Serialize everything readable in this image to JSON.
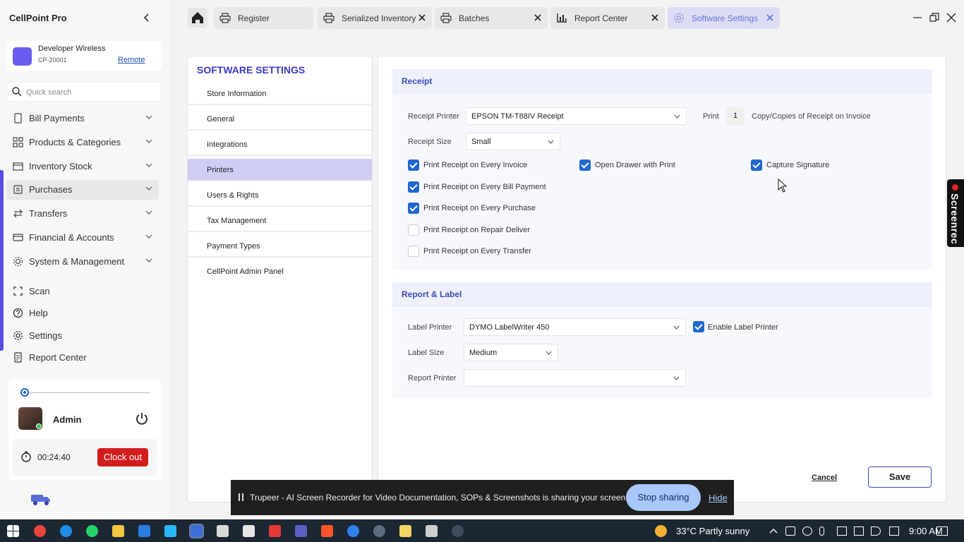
{
  "app": {
    "title": "CellPoint Pro"
  },
  "store": {
    "name": "Developer Wireless",
    "code": "CP-20001",
    "remote_label": "Remote"
  },
  "search": {
    "placeholder": "Quick search"
  },
  "nav": {
    "groups": [
      {
        "label": "Bill Payments",
        "icon": "receipt-icon"
      },
      {
        "label": "Products & Categories",
        "icon": "categories-icon"
      },
      {
        "label": "Inventory Stock",
        "icon": "inventory-icon"
      },
      {
        "label": "Purchases",
        "icon": "purchases-icon",
        "active": true
      },
      {
        "label": "Transfers",
        "icon": "transfers-icon"
      },
      {
        "label": "Financial & Accounts",
        "icon": "finance-icon"
      },
      {
        "label": "System & Management",
        "icon": "system-icon"
      }
    ],
    "links": [
      {
        "label": "Scan",
        "icon": "scan-icon"
      },
      {
        "label": "Help",
        "icon": "help-icon"
      },
      {
        "label": "Settings",
        "icon": "settings-icon"
      },
      {
        "label": "Report Center",
        "icon": "report-icon"
      }
    ]
  },
  "user": {
    "name": "Admin",
    "timer": "00:24:40",
    "clock_out_label": "Clock out"
  },
  "tabs": [
    {
      "label": "Register",
      "icon": "printer-icon"
    },
    {
      "label": "Serialized Inventory",
      "icon": "printer-icon"
    },
    {
      "label": "Batches",
      "icon": "printer-icon"
    },
    {
      "label": "Report Center",
      "icon": "chart-icon"
    },
    {
      "label": "Software Settings",
      "icon": "gear-icon",
      "active": true
    }
  ],
  "settings_menu": {
    "title": "SOFTWARE SETTINGS",
    "items": [
      "Store Information",
      "General",
      "Integrations",
      "Printers",
      "Users & Rights",
      "Tax Management",
      "Payment Types",
      "CellPoint Admin Panel"
    ],
    "active": "Printers"
  },
  "receipt": {
    "heading": "Receipt",
    "printer_label": "Receipt Printer",
    "printer_value": "EPSON TM-T88IV Receipt",
    "print_label": "Print",
    "copies": "1",
    "copies_suffix": "Copy/Copies of Receipt on Invoice",
    "size_label": "Receipt Size",
    "size_value": "Small",
    "checks": [
      {
        "label": "Print Receipt on Every Invoice",
        "checked": true
      },
      {
        "label": "Open Drawer with Print",
        "checked": true
      },
      {
        "label": "Capture Signature",
        "checked": true
      },
      {
        "label": "Print Receipt on Every Bill Payment",
        "checked": true
      },
      {
        "label": "Print Receipt on Every Purchase",
        "checked": true
      },
      {
        "label": "Print Receipt on Repair Deliver",
        "checked": false
      },
      {
        "label": "Print Receipt on Every Transfer",
        "checked": false
      }
    ]
  },
  "report_label": {
    "heading": "Report & Label",
    "label_printer_label": "Label Printer",
    "label_printer_value": "DYMO LabelWriter 450",
    "enable_label": "Enable Label Printer",
    "enable_checked": true,
    "label_size_label": "Label Size",
    "label_size_value": "Medium",
    "report_printer_label": "Report Printer",
    "report_printer_value": ""
  },
  "actions": {
    "cancel": "Cancel",
    "save": "Save"
  },
  "share_bar": {
    "text": "Trupeer - AI Screen Recorder for Video Documentation, SOPs & Screenshots is sharing your screen.",
    "stop": "Stop sharing",
    "hide": "Hide"
  },
  "screenrec": {
    "label": "Screenrec"
  },
  "taskbar": {
    "weather": "33°C  Partly sunny",
    "time": "9:00 AM"
  },
  "colors": {
    "accent": "#3a3ac8",
    "active_menu": "#cfcdf4",
    "checkbox": "#2068d0",
    "clock_out": "#d21d1d"
  }
}
